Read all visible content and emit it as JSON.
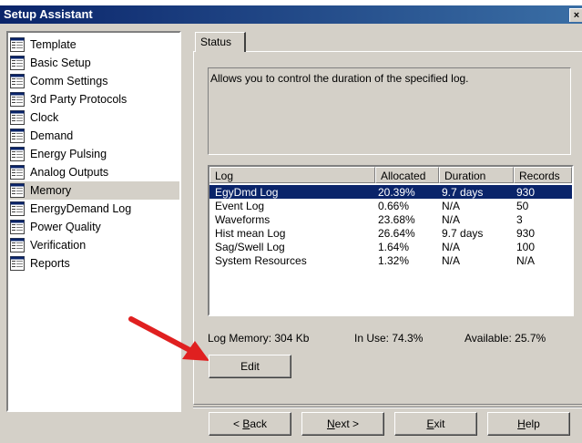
{
  "window": {
    "title": "Setup Assistant",
    "close_glyph": "×"
  },
  "sidebar": {
    "items": [
      {
        "label": "Template",
        "icon": "document-list-icon"
      },
      {
        "label": "Basic Setup",
        "icon": "document-list-icon"
      },
      {
        "label": "Comm Settings",
        "icon": "document-list-icon"
      },
      {
        "label": "3rd Party Protocols",
        "icon": "document-list-icon"
      },
      {
        "label": "Clock",
        "icon": "document-list-icon"
      },
      {
        "label": "Demand",
        "icon": "document-list-icon"
      },
      {
        "label": "Energy Pulsing",
        "icon": "document-list-icon"
      },
      {
        "label": "Analog Outputs",
        "icon": "document-list-icon"
      },
      {
        "label": "Memory",
        "icon": "document-list-icon",
        "selected": true
      },
      {
        "label": "EnergyDemand Log",
        "icon": "document-list-icon"
      },
      {
        "label": "Power Quality",
        "icon": "document-list-icon"
      },
      {
        "label": "Verification",
        "icon": "document-list-icon"
      },
      {
        "label": "Reports",
        "icon": "document-list-icon"
      }
    ]
  },
  "tabs": [
    {
      "label": "Status",
      "active": true
    }
  ],
  "status": {
    "description": "Allows you to control the duration of the specified log.",
    "table": {
      "columns": [
        "Log",
        "Allocated",
        "Duration",
        "Records"
      ],
      "rows": [
        [
          "EgyDmd Log",
          "20.39%",
          "9.7 days",
          "930"
        ],
        [
          "Event Log",
          "0.66%",
          "N/A",
          "50"
        ],
        [
          "Waveforms",
          "23.68%",
          "N/A",
          "3"
        ],
        [
          "Hist mean Log",
          "26.64%",
          "9.7 days",
          "930"
        ],
        [
          "Sag/Swell Log",
          "1.64%",
          "N/A",
          "100"
        ],
        [
          "System Resources",
          "1.32%",
          "N/A",
          "N/A"
        ]
      ],
      "selected_row": 0
    },
    "log_memory": "Log Memory:  304 Kb",
    "in_use": "In Use:  74.3%",
    "available": "Available:  25.7%",
    "edit_label": "Edit"
  },
  "nav": {
    "back": {
      "prefix": "< ",
      "mnemonic": "B",
      "rest": "ack"
    },
    "next": {
      "mnemonic": "N",
      "rest": "ext >"
    },
    "exit": {
      "mnemonic": "E",
      "rest": "xit"
    },
    "help": {
      "mnemonic": "H",
      "rest": "elp"
    }
  },
  "colors": {
    "title_bar": "#0a246a",
    "selection": "#0a246a",
    "face": "#d4d0c8",
    "arrow": "#e02020"
  }
}
